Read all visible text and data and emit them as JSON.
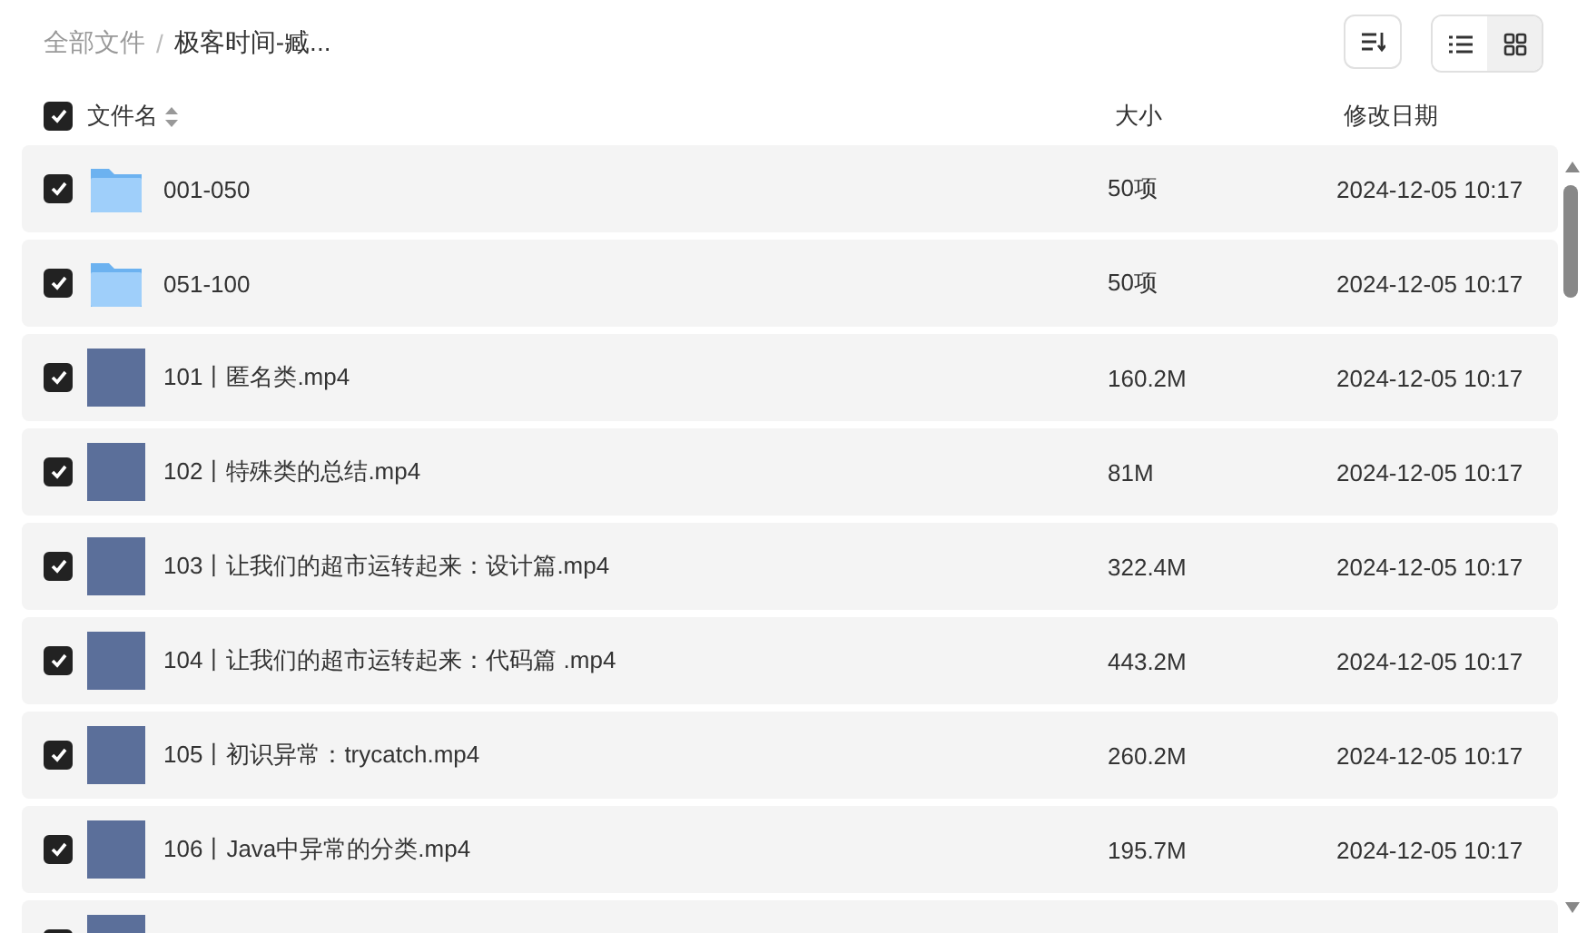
{
  "breadcrumb": [
    {
      "label": "全部文件",
      "current": false
    },
    {
      "label": "极客时间-臧...",
      "current": true
    }
  ],
  "breadcrumb_separator": "/",
  "view_toggle": [
    {
      "kind": "list",
      "selected": false
    },
    {
      "kind": "grid",
      "selected": true
    }
  ],
  "header": {
    "checked": true,
    "columns": [
      "文件名",
      "大小",
      "修改日期"
    ]
  },
  "rows": [
    {
      "kind": "folder",
      "checked": true,
      "name": "001-050",
      "size": "50项",
      "date": "2024-12-05 10:17"
    },
    {
      "kind": "folder",
      "checked": true,
      "name": "051-100",
      "size": "50项",
      "date": "2024-12-05 10:17"
    },
    {
      "kind": "video",
      "checked": true,
      "name": "101丨匿名类.mp4",
      "size": "160.2M",
      "date": "2024-12-05 10:17"
    },
    {
      "kind": "video",
      "checked": true,
      "name": "102丨特殊类的总结.mp4",
      "size": "81M",
      "date": "2024-12-05 10:17"
    },
    {
      "kind": "video",
      "checked": true,
      "name": "103丨让我们的超市运转起来：设计篇.mp4",
      "size": "322.4M",
      "date": "2024-12-05 10:17"
    },
    {
      "kind": "video",
      "checked": true,
      "name": "104丨让我们的超市运转起来：代码篇 .mp4",
      "size": "443.2M",
      "date": "2024-12-05 10:17"
    },
    {
      "kind": "video",
      "checked": true,
      "name": "105丨初识异常：trycatch.mp4",
      "size": "260.2M",
      "date": "2024-12-05 10:17"
    },
    {
      "kind": "video",
      "checked": true,
      "name": "106丨Java中异常的分类.mp4",
      "size": "195.7M",
      "date": "2024-12-05 10:17"
    },
    {
      "kind": "video",
      "checked": true
    }
  ]
}
